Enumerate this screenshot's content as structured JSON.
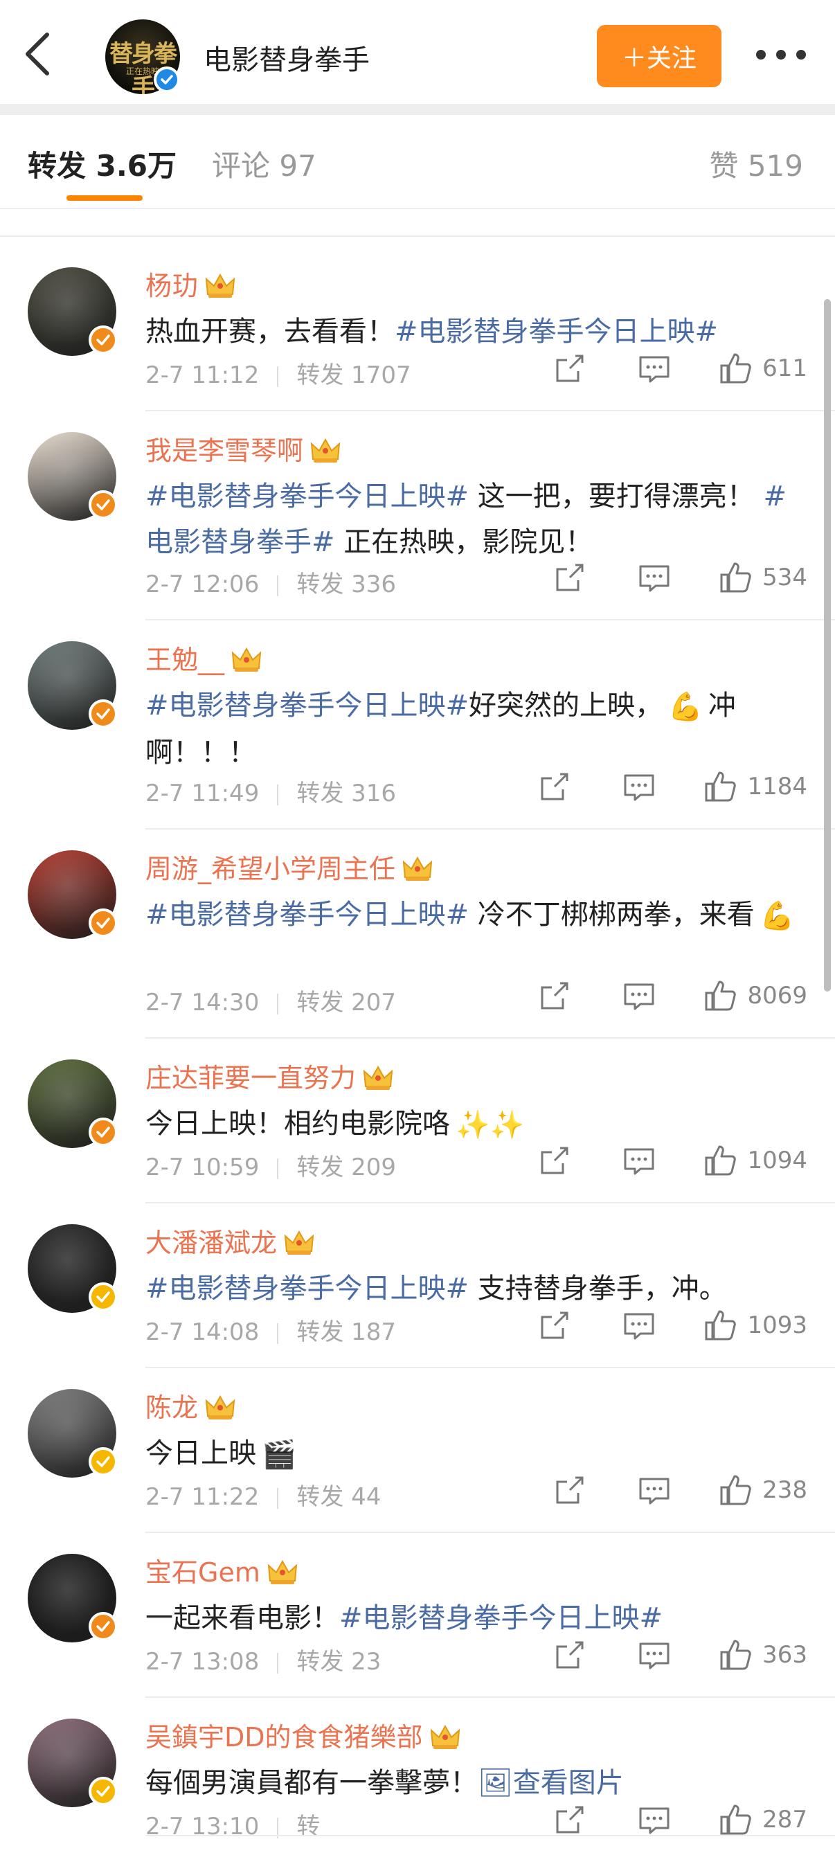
{
  "header": {
    "account_name": "电影替身拳手",
    "logo_text": "替身拳手",
    "logo_sub": "正在热映",
    "follow_label": "＋关注"
  },
  "tabs": {
    "repost": "转发 3.6万",
    "comment": "评论 97",
    "like": "赞 519"
  },
  "colors": {
    "accent": "#ff8200",
    "username": "#eb7350",
    "hashtag": "#4a6ba3",
    "vip_orange": "#f08a1b",
    "vip_yellow": "#f5b700"
  },
  "reposts": [
    {
      "name": "杨玏",
      "badge": "orange",
      "avatar_color": "#4a4a3e",
      "date": "2-7 11:12",
      "repost": "转发 1707",
      "likes": "611",
      "segments": [
        {
          "t": "热血开赛，去看看！"
        },
        {
          "t": "#电影替身拳手今日上映#",
          "tag": true
        }
      ]
    },
    {
      "name": "我是李雪琴啊",
      "badge": "orange",
      "avatar_color": "#e8ddd0",
      "date": "2-7 12:06",
      "repost": "转发 336",
      "likes": "534",
      "segments": [
        {
          "t": "#电影替身拳手今日上映#",
          "tag": true
        },
        {
          "t": " 这一把，要打得漂亮！ "
        },
        {
          "t": "#电影替身拳手#",
          "tag": true
        },
        {
          "t": " 正在热映，影院见！"
        }
      ]
    },
    {
      "name": "王勉__",
      "badge": "orange",
      "avatar_color": "#6d7a78",
      "date": "2-7 11:49",
      "repost": "转发 316",
      "likes": "1184",
      "segments": [
        {
          "t": "#电影替身拳手今日上映#",
          "tag": true
        },
        {
          "t": "好突然的上映，"
        },
        {
          "t": "💪",
          "emoji": true
        },
        {
          "t": "冲啊！！！"
        }
      ]
    },
    {
      "name": "周游_希望小学周主任",
      "badge": "orange",
      "avatar_color": "#b23a2e",
      "date": "2-7 14:30",
      "repost": "转发 207",
      "likes": "8069",
      "segments": [
        {
          "t": "#电影替身拳手今日上映#",
          "tag": true
        },
        {
          "t": " 冷不丁梆梆两拳，来看"
        },
        {
          "t": "💪",
          "emoji": true
        }
      ]
    },
    {
      "name": "庄达菲要一直努力",
      "badge": "orange",
      "avatar_color": "#5a6b3a",
      "date": "2-7 10:59",
      "repost": "转发 209",
      "likes": "1094",
      "segments": [
        {
          "t": "今日上映！相约电影院咯"
        },
        {
          "t": "✨✨",
          "emoji": true
        }
      ]
    },
    {
      "name": "大潘潘斌龙",
      "badge": "yellow",
      "avatar_color": "#2a2a2a",
      "date": "2-7 14:08",
      "repost": "转发 187",
      "likes": "1093",
      "segments": [
        {
          "t": "#电影替身拳手今日上映#",
          "tag": true
        },
        {
          "t": " 支持替身拳手，冲。"
        }
      ]
    },
    {
      "name": "陈龙",
      "badge": "yellow",
      "avatar_color": "#7a7a7a",
      "date": "2-7 11:22",
      "repost": "转发 44",
      "likes": "238",
      "segments": [
        {
          "t": "今日上映"
        },
        {
          "t": "🎬",
          "emoji": true
        }
      ]
    },
    {
      "name": "宝石Gem",
      "badge": "orange",
      "avatar_color": "#1f1f1f",
      "date": "2-7 13:08",
      "repost": "转发 23",
      "likes": "363",
      "segments": [
        {
          "t": "一起来看电影！"
        },
        {
          "t": "#电影替身拳手今日上映#",
          "tag": true
        }
      ]
    },
    {
      "name": "吴鎮宇DD的食食猪樂部",
      "badge": "yellow",
      "avatar_color": "#8a6a78",
      "date": "2-7 13:10",
      "repost": "转",
      "likes": "287",
      "segments": [
        {
          "t": "每個男演員都有一拳擊夢！"
        },
        {
          "t": "🖼查看图片",
          "tag": true
        }
      ]
    }
  ]
}
